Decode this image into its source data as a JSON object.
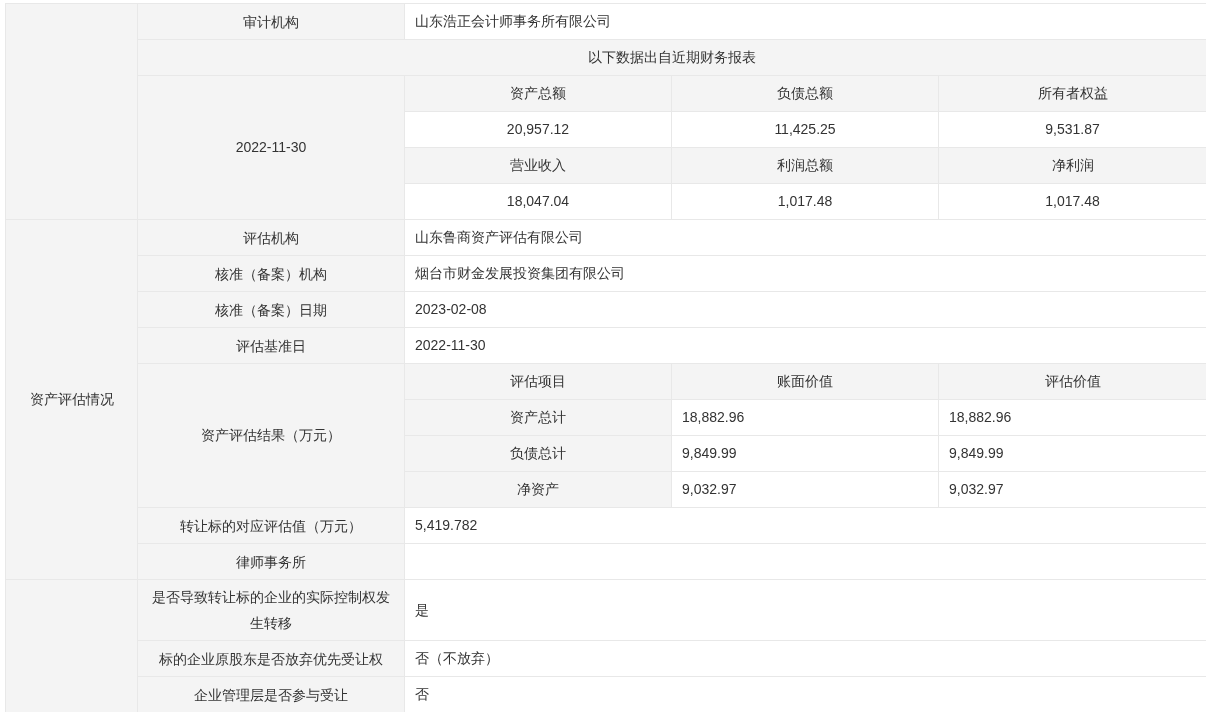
{
  "sections": [
    {
      "rows": [
        {
          "kind": "field",
          "label": "审计机构",
          "value": "山东浩正会计师事务所有限公司"
        },
        {
          "kind": "banner",
          "text": "以下数据出自近期财务报表"
        },
        {
          "kind": "financials",
          "date": "2022-11-30",
          "grid": [
            [
              "资产总额",
              "负债总额",
              "所有者权益"
            ],
            [
              "20,957.12",
              "11,425.25",
              "9,531.87"
            ],
            [
              "营业收入",
              "利润总额",
              "净利润"
            ],
            [
              "18,047.04",
              "1,017.48",
              "1,017.48"
            ]
          ]
        }
      ]
    },
    {
      "label": "资产评估情况",
      "rows": [
        {
          "kind": "field",
          "label": "评估机构",
          "value": "山东鲁商资产评估有限公司"
        },
        {
          "kind": "field",
          "label": "核准（备案）机构",
          "value": "烟台市财金发展投资集团有限公司"
        },
        {
          "kind": "field",
          "label": "核准（备案）日期",
          "value": "2023-02-08"
        },
        {
          "kind": "field",
          "label": "评估基准日",
          "value": "2022-11-30"
        },
        {
          "kind": "valuation",
          "label": "资产评估结果（万元）",
          "columns": [
            "评估项目",
            "账面价值",
            "评估价值"
          ],
          "rows": [
            {
              "item": "资产总计",
              "book": "18,882.96",
              "appraised": "18,882.96"
            },
            {
              "item": "负债总计",
              "book": "9,849.99",
              "appraised": "9,849.99"
            },
            {
              "item": "净资产",
              "book": "9,032.97",
              "appraised": "9,032.97"
            }
          ]
        },
        {
          "kind": "field",
          "label": "转让标的对应评估值（万元）",
          "value": "5,419.782"
        },
        {
          "kind": "field",
          "label": "律师事务所"
        }
      ]
    },
    {
      "rows": [
        {
          "kind": "field",
          "label": "是否导致转让标的企业的实际控制权发生转移",
          "value": "是"
        },
        {
          "kind": "field",
          "label": "标的企业原股东是否放弃优先受让权",
          "value": "否（不放弃）"
        },
        {
          "kind": "field",
          "label": "企业管理层是否参与受让",
          "value": "否"
        }
      ]
    }
  ]
}
